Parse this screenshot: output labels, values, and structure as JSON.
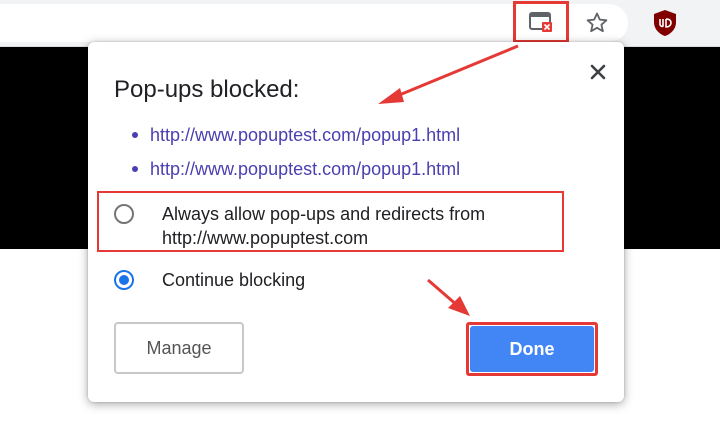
{
  "dialog": {
    "title": "Pop-ups blocked:",
    "links": [
      "http://www.popuptest.com/popup1.html",
      "http://www.popuptest.com/popup1.html"
    ],
    "options": [
      {
        "label": "Always allow pop-ups and redirects from http://www.popuptest.com",
        "selected": false
      },
      {
        "label": "Continue blocking",
        "selected": true
      }
    ],
    "manage_label": "Manage",
    "done_label": "Done"
  },
  "toolbar": {
    "icons": [
      "popup-blocked-icon",
      "star-icon",
      "ublock-origin-icon"
    ]
  },
  "colors": {
    "accent": "#1a73e8",
    "done_button": "#4285f4",
    "link": "#4a3fb0",
    "annotation": "#e53935"
  }
}
